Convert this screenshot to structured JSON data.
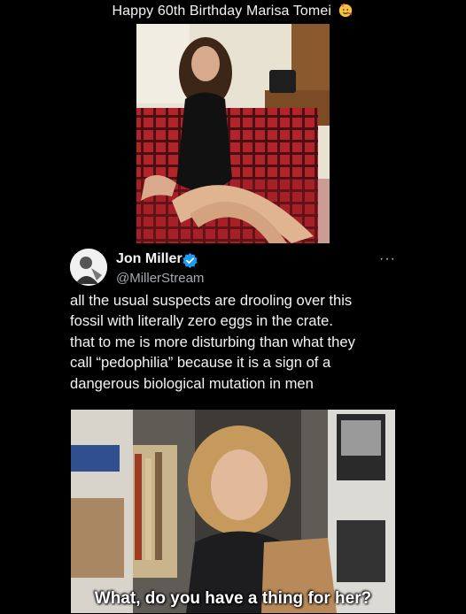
{
  "header": {
    "caption": "Happy 60th Birthday Marisa Tomei",
    "emoji_icon": "party-face-icon"
  },
  "tweet": {
    "author_name": "Jon Miller",
    "author_handle": "@MillerStream",
    "verified_icon": "verified-badge-icon",
    "more_label": "···",
    "body_lines": [
      "all the usual suspects are drooling over this",
      "fossil with literally zero eggs in the crate.",
      "that to me is more disturbing than what they",
      "call “pedophilia” because it is a sign of a",
      "dangerous biological mutation in men"
    ]
  },
  "bottom_image": {
    "subtitle": "What, do you have a thing for her?"
  },
  "colors": {
    "background": "#000000",
    "verified_blue": "#1d9bf0",
    "handle_gray": "#a4aab0"
  }
}
